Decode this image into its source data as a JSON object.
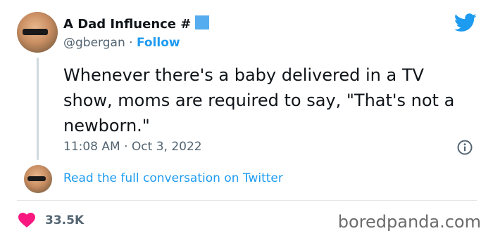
{
  "author": {
    "name": "A Dad Influence #",
    "handle": "@gbergan",
    "separator": "·",
    "follow_label": "Follow"
  },
  "tweet": {
    "text": "Whenever there's a baby delivered in a TV show, moms are required to say, \"That's not a newborn.\"",
    "time": "11:08 AM",
    "date_separator": "·",
    "date": "Oct 3, 2022"
  },
  "conversation_link": "Read the full conversation on Twitter",
  "likes": "33.5K",
  "watermark": "boredpanda.com",
  "colors": {
    "twitter_blue": "#1d9bf0",
    "heart": "#f91880",
    "flag": "#55acee"
  },
  "icons": {
    "brand": "twitter-bird-icon",
    "info": "info-icon",
    "like": "heart-icon"
  }
}
